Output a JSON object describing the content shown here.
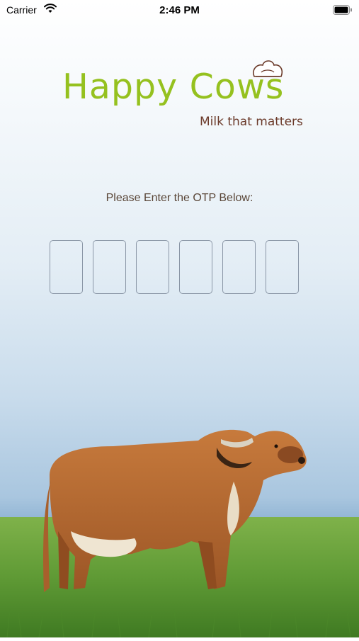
{
  "status_bar": {
    "carrier": "Carrier",
    "time": "2:46 PM"
  },
  "logo": {
    "brand": "Happy Cows",
    "tagline": "Milk that matters"
  },
  "otp": {
    "prompt": "Please Enter the OTP Below:",
    "digits": [
      "",
      "",
      "",
      "",
      "",
      ""
    ]
  },
  "colors": {
    "brand_green": "#95c11f",
    "tagline_brown": "#6b3a2a",
    "box_border": "#8a96a6"
  },
  "icons": [
    "wifi-icon",
    "battery-icon",
    "chef-hat-icon",
    "cow-illustration"
  ]
}
